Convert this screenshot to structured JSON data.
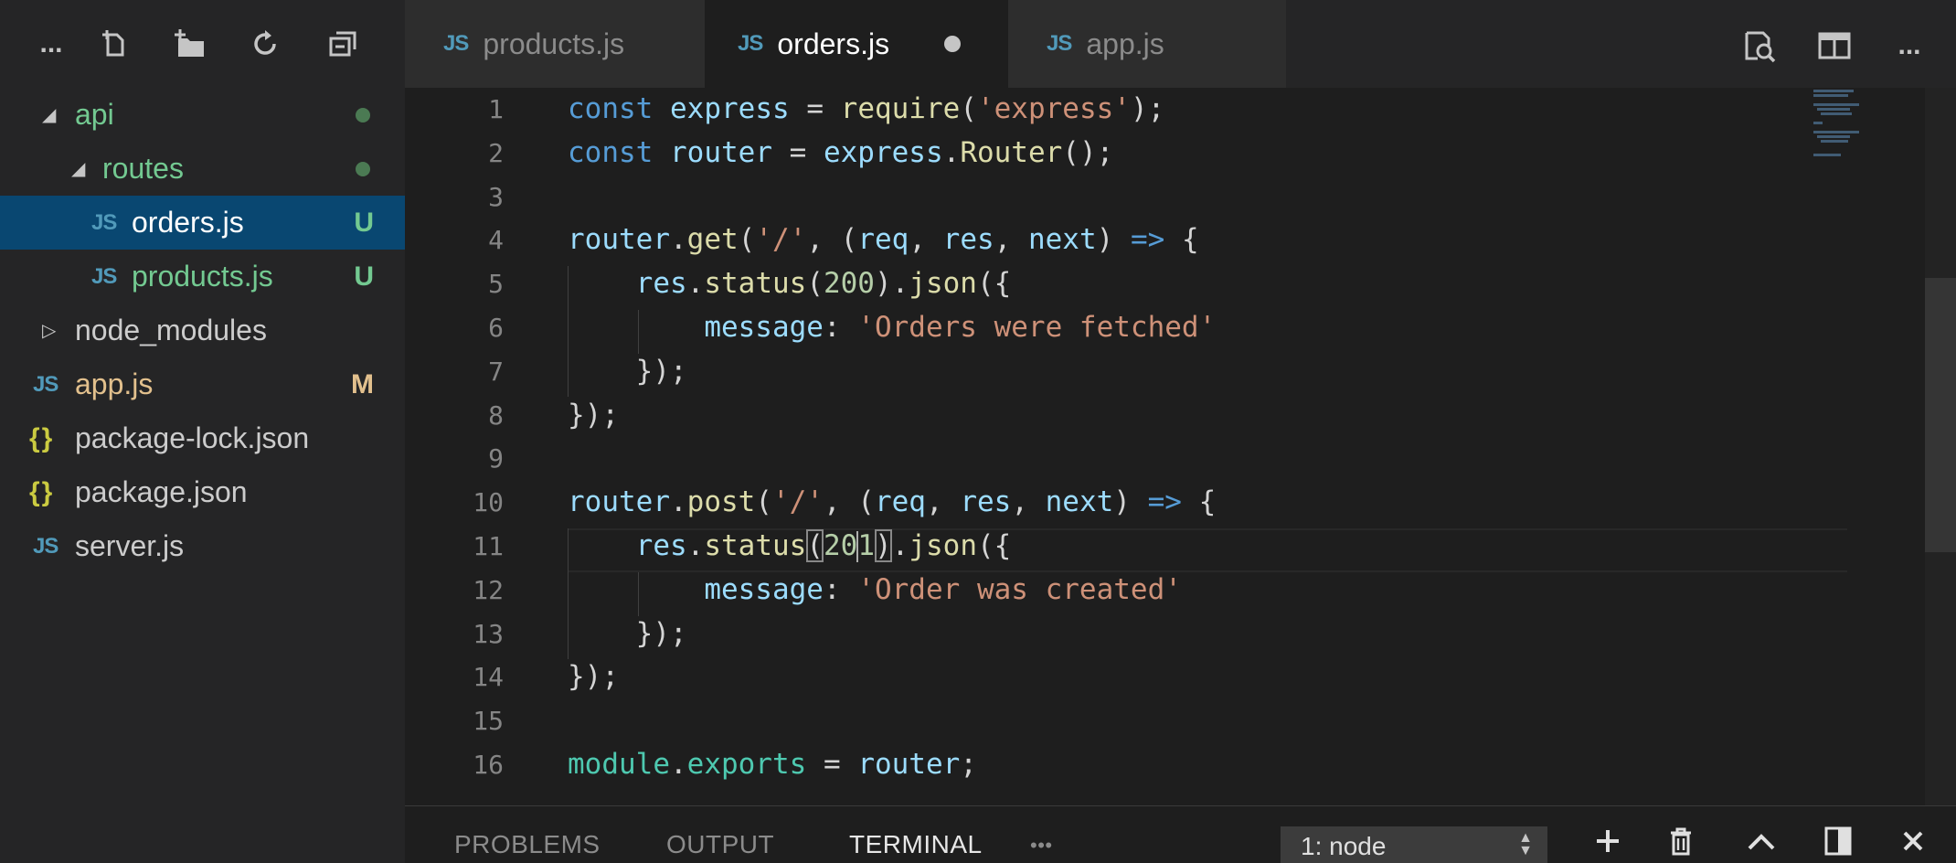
{
  "sidebar": {
    "toolbar": {
      "more": "...",
      "new_file_icon": "new-file-icon",
      "new_folder_icon": "new-folder-icon",
      "refresh_icon": "refresh-icon",
      "collapse_icon": "collapse-all-icon"
    },
    "items": [
      {
        "label": "api",
        "type": "folder-open",
        "status": "dot"
      },
      {
        "label": "routes",
        "type": "folder-open",
        "status": "dot"
      },
      {
        "label": "orders.js",
        "type": "js",
        "badge": "U"
      },
      {
        "label": "products.js",
        "type": "js",
        "badge": "U"
      },
      {
        "label": "node_modules",
        "type": "folder-closed"
      },
      {
        "label": "app.js",
        "type": "js",
        "badge": "M"
      },
      {
        "label": "package-lock.json",
        "type": "json"
      },
      {
        "label": "package.json",
        "type": "json"
      },
      {
        "label": "server.js",
        "type": "js"
      }
    ],
    "js_icon": "JS",
    "json_icon": "{}"
  },
  "tabs": [
    {
      "label": "products.js",
      "icon": "JS"
    },
    {
      "label": "orders.js",
      "icon": "JS",
      "active": true,
      "dirty": true
    },
    {
      "label": "app.js",
      "icon": "JS"
    }
  ],
  "editor_actions": {
    "more": "..."
  },
  "editor": {
    "line_numbers": [
      "1",
      "2",
      "3",
      "4",
      "5",
      "6",
      "7",
      "8",
      "9",
      "10",
      "11",
      "12",
      "13",
      "14",
      "15",
      "16"
    ],
    "code": {
      "l1": {
        "kw": "const",
        "var": "express",
        "eq": " = ",
        "fn": "require",
        "open": "(",
        "str": "'express'",
        "close": ");"
      },
      "l2": {
        "kw": "const",
        "var": "router",
        "eq": " = ",
        "obj": "express",
        "dot": ".",
        "fn": "Router",
        "close": "();"
      },
      "l4": {
        "obj": "router",
        "dot": ".",
        "fn": "get",
        "open": "(",
        "str": "'/'",
        "comma": ", (",
        "p1": "req",
        "c1": ", ",
        "p2": "res",
        "c2": ", ",
        "p3": "next",
        "c3": ") ",
        "arrow": "=>",
        "brace": " {"
      },
      "l5": {
        "obj": "res",
        "dot": ".",
        "fn": "status",
        "open": "(",
        "num": "200",
        "close": ").",
        "fn2": "json",
        "tail": "({"
      },
      "l6": {
        "prop": "message",
        "colon": ": ",
        "str": "'Orders were fetched'"
      },
      "l7": {
        "text": "});"
      },
      "l8": {
        "text": "});"
      },
      "l10": {
        "obj": "router",
        "dot": ".",
        "fn": "post",
        "open": "(",
        "str": "'/'",
        "comma": ", (",
        "p1": "req",
        "c1": ", ",
        "p2": "res",
        "c2": ", ",
        "p3": "next",
        "c3": ") ",
        "arrow": "=>",
        "brace": " {"
      },
      "l11": {
        "obj": "res",
        "dot": ".",
        "fn": "status",
        "open": "(",
        "num_a": "20",
        "num_b": "1",
        "close": ")",
        "dot2": ".",
        "fn2": "json",
        "tail": "({"
      },
      "l12": {
        "prop": "message",
        "colon": ": ",
        "str": "'Order was created'"
      },
      "l13": {
        "text": "});"
      },
      "l14": {
        "text": "});"
      },
      "l16": {
        "mod": "module",
        "dot": ".",
        "prop": "exports",
        "eq": " = ",
        "var": "router",
        "semi": ";"
      }
    }
  },
  "panel": {
    "tabs": [
      "PROBLEMS",
      "OUTPUT",
      "TERMINAL"
    ],
    "more": "•••",
    "terminal_select": "1: node",
    "add_icon": "plus-icon",
    "trash_icon": "trash-icon",
    "maximize_icon": "chevron-up-icon",
    "split_icon": "split-panel-icon",
    "close_icon": "close-icon"
  }
}
